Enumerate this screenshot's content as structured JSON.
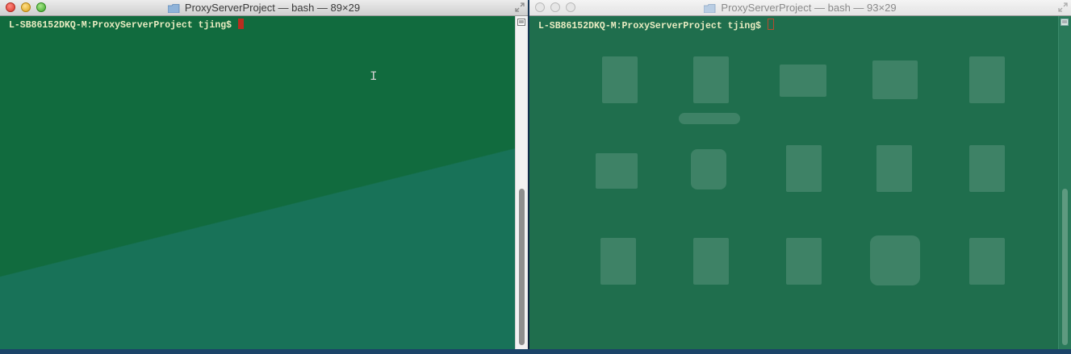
{
  "windows": [
    {
      "title": "ProxyServerProject — bash — 89×29",
      "prompt": "L-SB86152DKQ-M:ProxyServerProject tjing$ "
    },
    {
      "title": "ProxyServerProject — bash — 93×29",
      "prompt": "L-SB86152DKQ-M:ProxyServerProject tjing$ "
    }
  ],
  "colors": {
    "terminal_bg": "#116b3e",
    "prompt_text": "#e9ecc2",
    "cursor": "#b82e1f"
  },
  "icons": [
    "folder-icon",
    "fullscreen-icon",
    "close-button",
    "minimize-button",
    "zoom-button",
    "scroll-up-icon",
    "ibeam-cursor-icon"
  ]
}
